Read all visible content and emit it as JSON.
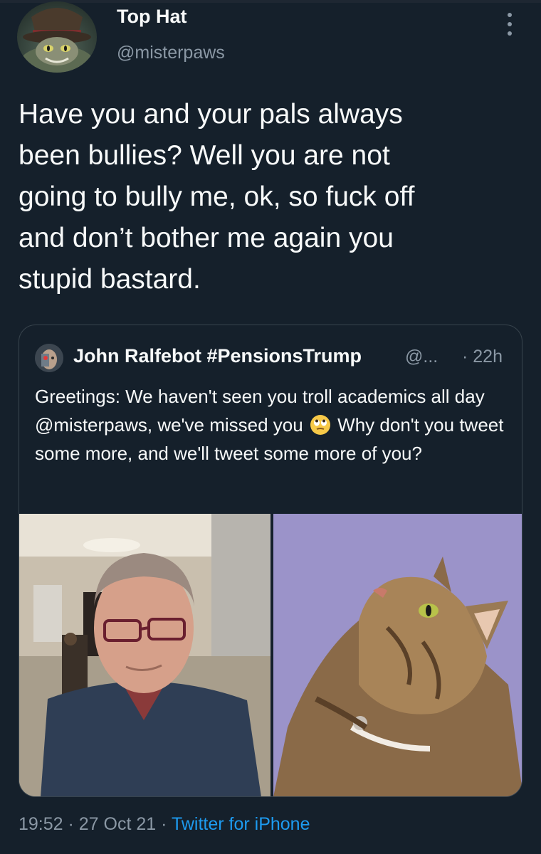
{
  "tweet": {
    "author_name": "Top Hat",
    "author_handle": "@misterpaws",
    "text": "Have you and your pals always\nbeen bullies? Well you are not\ngoing to bully me, ok, so fuck off\nand don’t bother me again you\nstupid bastard.",
    "time": "19:52",
    "sep1": " · ",
    "date": "27 Oct 21",
    "sep2": " · ",
    "source": "Twitter for iPhone"
  },
  "quote": {
    "author_name": "John Ralfebot #PensionsTrump",
    "author_handle": "@...",
    "time": "· 22h",
    "text_part1": "Greetings: We haven't seen you troll academics all day @misterpaws, we've missed you",
    "emoji": "face-with-rolling-eyes",
    "text_part2": "Why don't you tweet some more, and we'll tweet some more of you?"
  },
  "colors": {
    "background": "#15202b",
    "primary_text": "#f7f9f9",
    "secondary_text": "#8b98a5",
    "link": "#1d9bf0",
    "border": "#38444d",
    "media_right_bg": "#9b93c9"
  }
}
